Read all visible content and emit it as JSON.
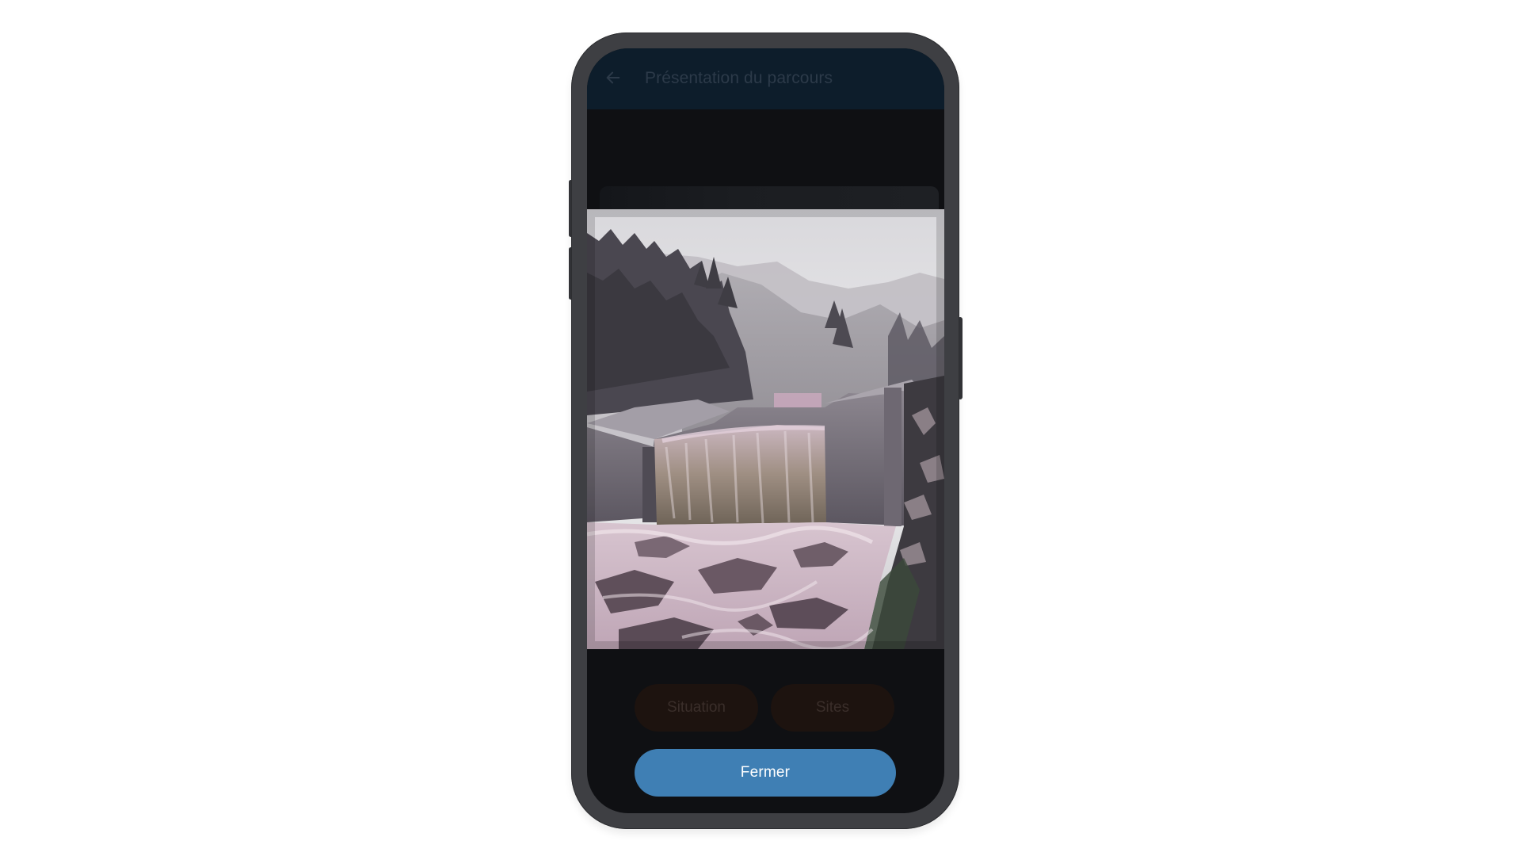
{
  "appbar": {
    "title": "Présentation du parcours",
    "back_icon": "arrow-left-icon",
    "background": "#0d1d2b"
  },
  "photo": {
    "subject": "mountain-check-dam-waterfall"
  },
  "tabs": [
    {
      "label": "Situation"
    },
    {
      "label": "Sites"
    }
  ],
  "footer": {
    "close_label": "Fermer",
    "close_color": "#3f7fb4"
  },
  "colors": {
    "phone_frame": "#3e3f43",
    "screen_background": "#0f1013",
    "chip_background": "#1d130f"
  }
}
